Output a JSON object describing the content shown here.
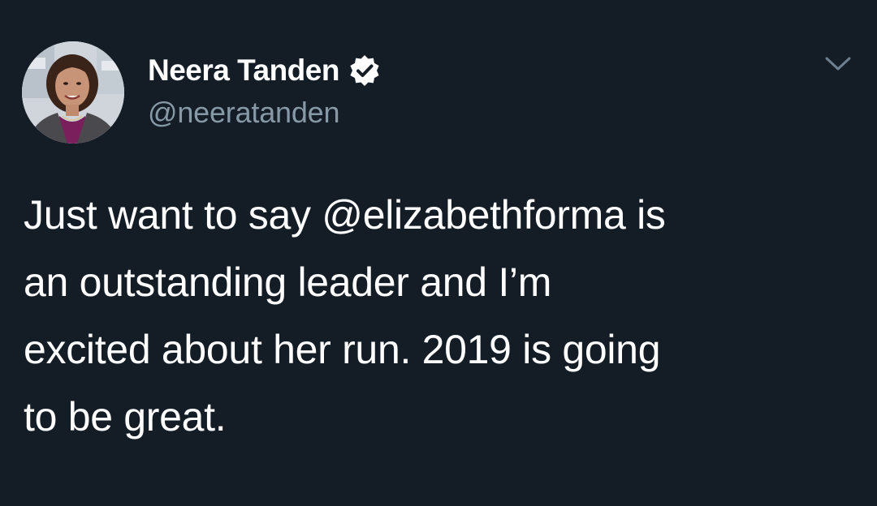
{
  "author": {
    "display_name": "Neera Tanden",
    "handle": "@neeratanden",
    "verified": true,
    "avatar_icon": "profile-photo"
  },
  "tweet": {
    "lines": [
      "Just want to say @elizabethforma is",
      "an outstanding leader and I’m",
      "excited about her run. 2019 is going",
      "to be great."
    ]
  },
  "icons": {
    "verified": "verified-badge-icon",
    "menu": "chevron-down-icon"
  },
  "colors": {
    "background": "#141d26",
    "text": "#ffffff",
    "secondary_text": "#8899a6"
  }
}
